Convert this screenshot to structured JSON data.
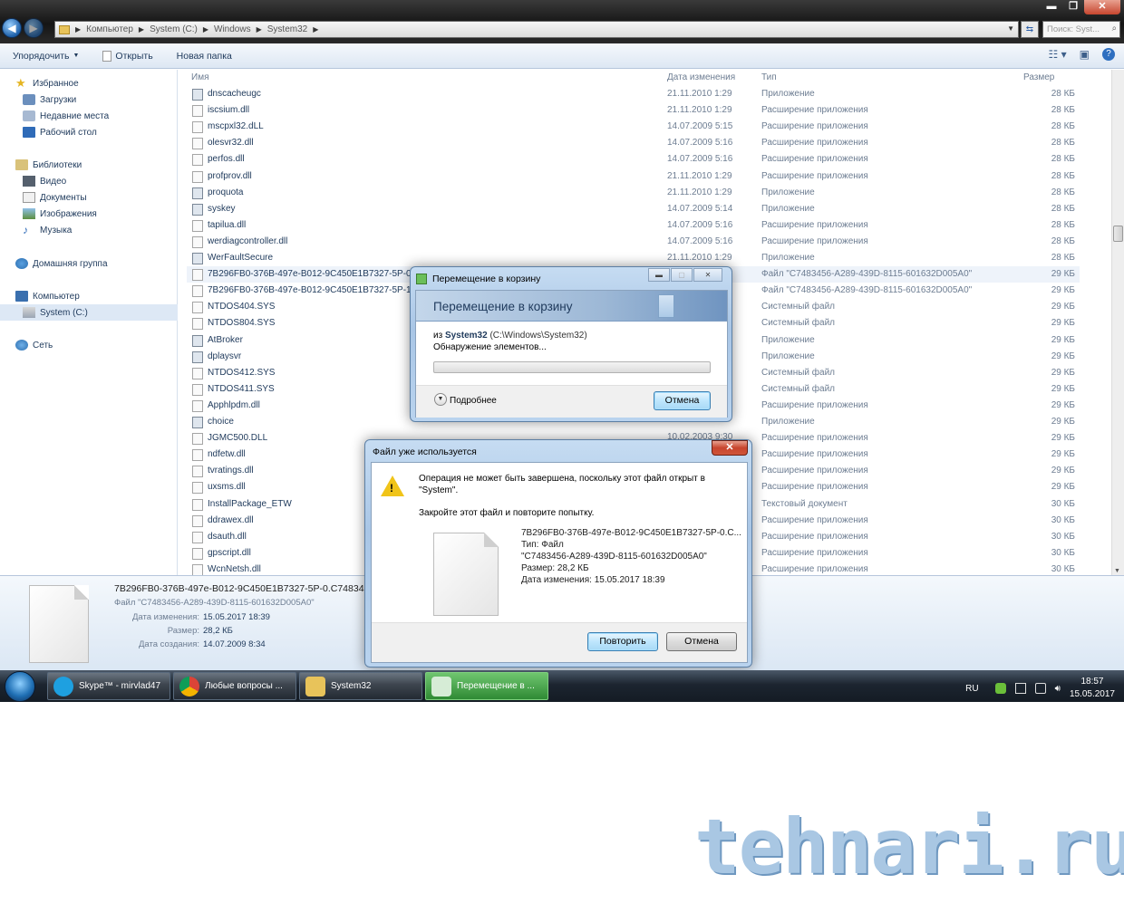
{
  "window": {
    "breadcrumbs": [
      "Компьютер",
      "System (C:)",
      "Windows",
      "System32"
    ],
    "search_placeholder": "Поиск: Syst...",
    "controls": {
      "minimize": "▬",
      "restore": "❐",
      "close": "✕"
    }
  },
  "toolbar": {
    "organize": "Упорядочить",
    "open": "Открыть",
    "new_folder": "Новая папка"
  },
  "sidebar": {
    "favorites": "Избранное",
    "downloads": "Загрузки",
    "recent": "Недавние места",
    "desktop": "Рабочий стол",
    "libraries": "Библиотеки",
    "video": "Видео",
    "documents": "Документы",
    "images": "Изображения",
    "music": "Музыка",
    "homegroup": "Домашняя группа",
    "computer": "Компьютер",
    "system_c": "System (C:)",
    "network": "Сеть"
  },
  "columns": {
    "name": "Имя",
    "date": "Дата изменения",
    "type": "Тип",
    "size": "Размер"
  },
  "files": [
    {
      "name": "dnscacheugc",
      "date": "21.11.2010 1:29",
      "type": "Приложение",
      "size": "28 КБ",
      "icon": "app"
    },
    {
      "name": "iscsium.dll",
      "date": "21.11.2010 1:29",
      "type": "Расширение приложения",
      "size": "28 КБ",
      "icon": "dll"
    },
    {
      "name": "mscpxl32.dLL",
      "date": "14.07.2009 5:15",
      "type": "Расширение приложения",
      "size": "28 КБ",
      "icon": "dll"
    },
    {
      "name": "olesvr32.dll",
      "date": "14.07.2009 5:16",
      "type": "Расширение приложения",
      "size": "28 КБ",
      "icon": "dll"
    },
    {
      "name": "perfos.dll",
      "date": "14.07.2009 5:16",
      "type": "Расширение приложения",
      "size": "28 КБ",
      "icon": "dll"
    },
    {
      "name": "profprov.dll",
      "date": "21.11.2010 1:29",
      "type": "Расширение приложения",
      "size": "28 КБ",
      "icon": "dll"
    },
    {
      "name": "proquota",
      "date": "21.11.2010 1:29",
      "type": "Приложение",
      "size": "28 КБ",
      "icon": "app"
    },
    {
      "name": "syskey",
      "date": "14.07.2009 5:14",
      "type": "Приложение",
      "size": "28 КБ",
      "icon": "app"
    },
    {
      "name": "tapilua.dll",
      "date": "14.07.2009 5:16",
      "type": "Расширение приложения",
      "size": "28 КБ",
      "icon": "dll"
    },
    {
      "name": "werdiagcontroller.dll",
      "date": "14.07.2009 5:16",
      "type": "Расширение приложения",
      "size": "28 КБ",
      "icon": "dll"
    },
    {
      "name": "WerFaultSecure",
      "date": "21.11.2010 1:29",
      "type": "Приложение",
      "size": "28 КБ",
      "icon": "app"
    },
    {
      "name": "7B296FB0-376B-497e-B012-9C450E1B7327-5P-0.C",
      "date": "",
      "type": "Файл \"C7483456-A289-439D-8115-601632D005A0\"",
      "size": "29 КБ",
      "icon": "file"
    },
    {
      "name": "7B296FB0-376B-497e-B012-9C450E1B7327-5P-1.C",
      "date": "",
      "type": "Файл \"C7483456-A289-439D-8115-601632D005A0\"",
      "size": "29 КБ",
      "icon": "file"
    },
    {
      "name": "NTDOS404.SYS",
      "date": "",
      "type": "Системный файл",
      "size": "29 КБ",
      "icon": "dll"
    },
    {
      "name": "NTDOS804.SYS",
      "date": "",
      "type": "Системный файл",
      "size": "29 КБ",
      "icon": "dll"
    },
    {
      "name": "AtBroker",
      "date": "",
      "type": "Приложение",
      "size": "29 КБ",
      "icon": "app"
    },
    {
      "name": "dplaysvr",
      "date": "",
      "type": "Приложение",
      "size": "29 КБ",
      "icon": "app"
    },
    {
      "name": "NTDOS412.SYS",
      "date": "",
      "type": "Системный файл",
      "size": "29 КБ",
      "icon": "dll"
    },
    {
      "name": "NTDOS411.SYS",
      "date": "",
      "type": "Системный файл",
      "size": "29 КБ",
      "icon": "dll"
    },
    {
      "name": "Apphlpdm.dll",
      "date": "",
      "type": "Расширение приложения",
      "size": "29 КБ",
      "icon": "dll"
    },
    {
      "name": "choice",
      "date": "",
      "type": "Приложение",
      "size": "29 КБ",
      "icon": "app"
    },
    {
      "name": "JGMC500.DLL",
      "date": "",
      "type": "Расширение приложения",
      "size": "29 КБ",
      "icon": "dll"
    },
    {
      "name": "ndfetw.dll",
      "date": "",
      "type": "Расширение приложения",
      "size": "29 КБ",
      "icon": "dll"
    },
    {
      "name": "tvratings.dll",
      "date": "",
      "type": "Расширение приложения",
      "size": "29 КБ",
      "icon": "dll"
    },
    {
      "name": "uxsms.dll",
      "date": "",
      "type": "Расширение приложения",
      "size": "29 КБ",
      "icon": "dll"
    },
    {
      "name": "InstallPackage_ETW",
      "date": "",
      "type": "Текстовый документ",
      "size": "30 КБ",
      "icon": "file"
    },
    {
      "name": "ddrawex.dll",
      "date": "",
      "type": "Расширение приложения",
      "size": "30 КБ",
      "icon": "dll"
    },
    {
      "name": "dsauth.dll",
      "date": "",
      "type": "Расширение приложения",
      "size": "30 КБ",
      "icon": "dll"
    },
    {
      "name": "gpscript.dll",
      "date": "",
      "type": "Расширение приложения",
      "size": "30 КБ",
      "icon": "dll"
    },
    {
      "name": "WcnNetsh.dll",
      "date": "",
      "type": "Расширение приложения",
      "size": "30 КБ",
      "icon": "dll"
    }
  ],
  "details": {
    "name": "7B296FB0-376B-497e-B012-9C450E1B7327-5P-0.C74834",
    "type": "Файл \"C7483456-A289-439D-8115-601632D005A0\"",
    "modified_label": "Дата изменения:",
    "modified": "15.05.2017 18:39",
    "size_label": "Размер:",
    "size": "28,2 КБ",
    "created_label": "Дата создания:",
    "created": "14.07.2009 8:34"
  },
  "recycle_dialog": {
    "title": "Перемещение в корзину",
    "heading": "Перемещение в корзину",
    "from_prefix": "из",
    "from_folder": "System32",
    "from_path": "(C:\\Windows\\System32)",
    "status": "Обнаружение элементов...",
    "progress": 0.0,
    "more": "Подробнее",
    "cancel": "Отмена",
    "behind_text": "10.02.2003 9:30"
  },
  "inuse_dialog": {
    "title": "Файл уже используется",
    "message": "Операция не может быть завершена, поскольку этот файл открыт в \"System\".",
    "hint": "Закройте этот файл и повторите попытку.",
    "file_name": "7B296FB0-376B-497e-B012-9C450E1B7327-5P-0.C...",
    "file_type": "Тип: Файл",
    "file_type2": "\"C7483456-A289-439D-8115-601632D005A0\"",
    "file_size": "Размер: 28,2 КБ",
    "file_date": "Дата изменения: 15.05.2017 18:39",
    "retry": "Повторить",
    "cancel": "Отмена"
  },
  "taskbar": {
    "tasks": [
      "Skype™ - mirvlad47",
      "Любые вопросы ...",
      "System32",
      "Перемещение в ..."
    ],
    "lang": "RU",
    "time": "18:57",
    "date": "15.05.2017"
  },
  "watermark": "tehnari.ru",
  "colors": {
    "accent": "#1e395b",
    "selection": "#dde8f5",
    "progress": "#3da32a",
    "close": "#c7452e"
  }
}
